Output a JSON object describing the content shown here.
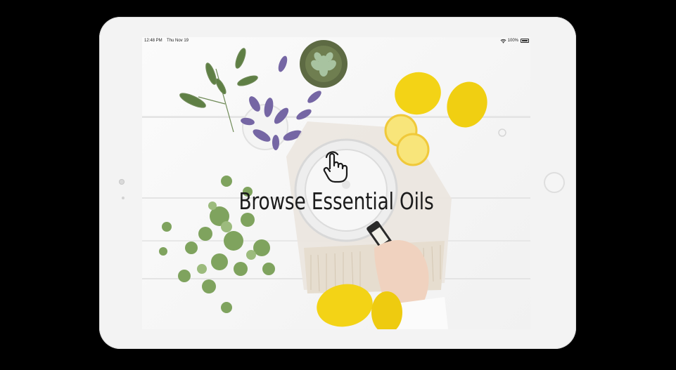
{
  "status_bar": {
    "time": "12:48 PM",
    "date": "Thu Nov 19",
    "battery": "100%"
  },
  "screen": {
    "title": "Browse Essential Oils",
    "tap_icon": "hand-pointer-icon"
  },
  "colors": {
    "background": "#000000",
    "frame": "#f3f3f3",
    "lemon": "#f2d21b",
    "lavender": "#6e5fa0",
    "leaf": "#5f8a4e"
  }
}
